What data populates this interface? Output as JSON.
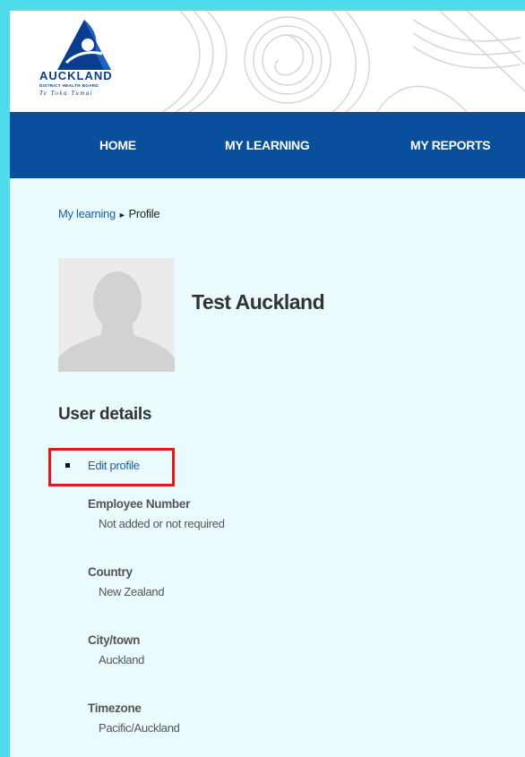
{
  "colors": {
    "outer_border": "#4fdcec",
    "page_bg": "#e9fbfd",
    "nav_bg": "#0a4f9e",
    "link": "#1a5fa6",
    "brand": "#0a3d8f",
    "highlight": "#e01b1b"
  },
  "logo": {
    "title": "AUCKLAND",
    "subtitle": "DISTRICT HEALTH BOARD",
    "tagline": "Te Toka Tumai",
    "icon": "auckland-dhb-logo"
  },
  "nav": {
    "items": [
      {
        "label": "HOME"
      },
      {
        "label": "MY LEARNING"
      },
      {
        "label": "MY REPORTS"
      }
    ]
  },
  "breadcrumb": {
    "parent": "My learning",
    "separator": "►",
    "current": "Profile"
  },
  "profile": {
    "name": "Test Auckland",
    "avatar_icon": "default-user-avatar"
  },
  "user_details": {
    "title": "User details",
    "edit_link": "Edit profile",
    "fields": [
      {
        "label": "Employee Number",
        "value": "Not added or not required"
      },
      {
        "label": "Country",
        "value": "New Zealand"
      },
      {
        "label": "City/town",
        "value": "Auckland"
      },
      {
        "label": "Timezone",
        "value": "Pacific/Auckland"
      }
    ]
  }
}
